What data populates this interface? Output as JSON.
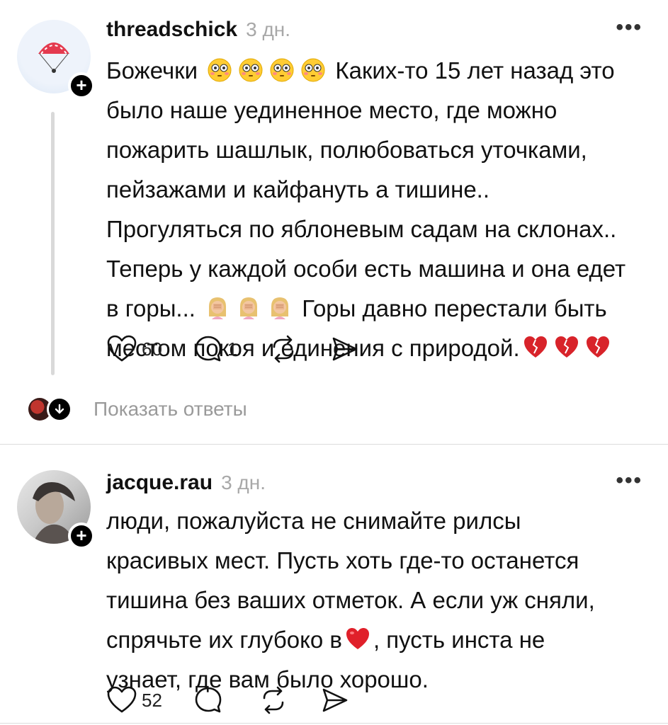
{
  "comments": [
    {
      "username": "threadschick",
      "time": "3 дн.",
      "more": "•••",
      "lines": [
        {
          "before": "Божечки ",
          "emoji": "flushed-face-emoji",
          "emoji_count": 4,
          "after": " Каких-то 15 лет назад это"
        },
        {
          "text": "было наше уединенное место, где можно"
        },
        {
          "text": "пожарить шашлык, полюбоваться уточками,"
        },
        {
          "text": "пейзажами и кайфануть а тишине.."
        },
        {
          "text": "Прогуляться по яблоневым садам на склонах.."
        },
        {
          "text": "Теперь у каждой особи есть машина и она едет"
        },
        {
          "before": "в горы... ",
          "emoji": "facepalm-emoji",
          "emoji_count": 3,
          "after": " Горы давно перестали быть"
        },
        {
          "before": "местом покоя и единения с природой.",
          "emoji": "broken-heart-emoji",
          "emoji_count": 3,
          "after": ""
        }
      ],
      "likes": "60",
      "replies": "1"
    },
    {
      "username": "jacque.rau",
      "time": "3 дн.",
      "more": "•••",
      "lines": [
        {
          "text": "люди, пожалуйста не снимайте рилсы"
        },
        {
          "text": "красивых мест. Пусть хоть где-то останется"
        },
        {
          "text": "тишина без ваших отметок. А если уж сняли,"
        },
        {
          "before": "спрячьте их глубоко в",
          "emoji": "red-heart-emoji",
          "emoji_count": 1,
          "after": ", пусть инста не"
        },
        {
          "text": "узнает, где вам было хорошо."
        }
      ],
      "likes": "52",
      "replies": ""
    }
  ],
  "show_replies": "Показать ответы",
  "colors": {
    "text": "#111111",
    "muted": "#a8a8a8",
    "heart_broken": "#d8232a",
    "line": "#d9d9d9"
  }
}
